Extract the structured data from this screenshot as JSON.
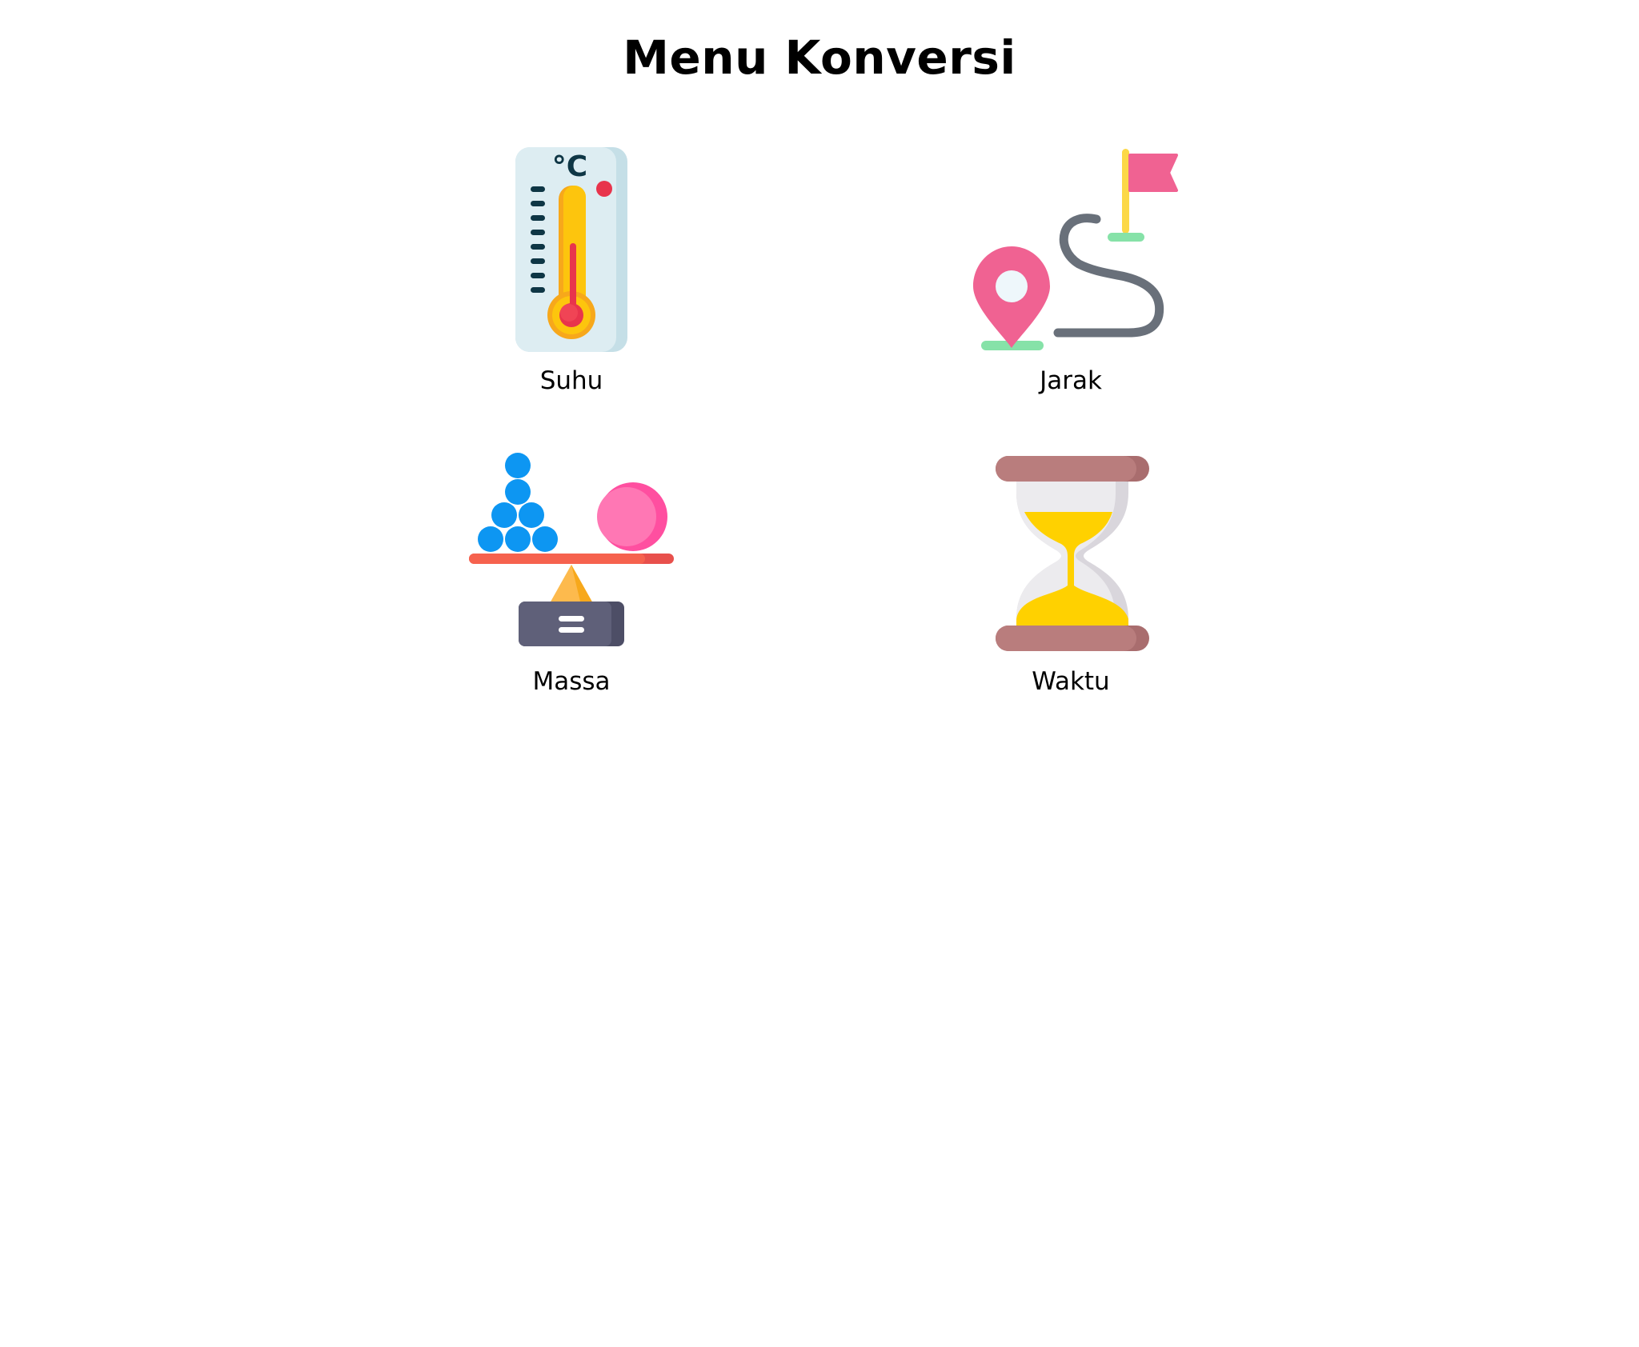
{
  "page": {
    "title": "Menu Konversi"
  },
  "menu": {
    "items": [
      {
        "label": "Suhu",
        "icon": "thermometer-icon"
      },
      {
        "label": "Jarak",
        "icon": "route-icon"
      },
      {
        "label": "Massa",
        "icon": "balance-scale-icon"
      },
      {
        "label": "Waktu",
        "icon": "hourglass-icon"
      }
    ]
  },
  "icons": {
    "thermometer_unit": "°C"
  },
  "colors": {
    "background": "#ffffff",
    "text": "#000000",
    "pin_pink": "#f06292",
    "flag_pink": "#f06292",
    "balls_blue": "#0d96f2",
    "sand_yellow": "#ffd100",
    "hourglass_brown": "#b97d7d",
    "scale_base": "#5f6079"
  }
}
